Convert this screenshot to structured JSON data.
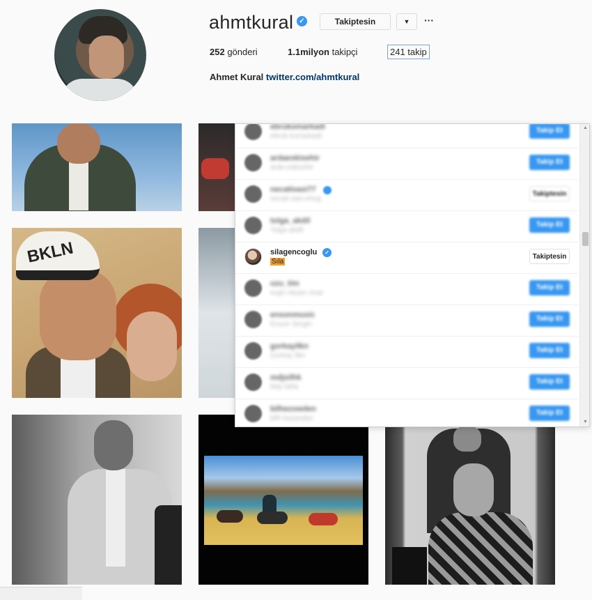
{
  "profile": {
    "username": "ahmtkural",
    "verified_mark": "✓",
    "follow_button": "Takiptesin",
    "dropdown_symbol": "▼",
    "more_symbol": "···",
    "posts_count": "252",
    "posts_label": "gönderi",
    "followers_count": "1.1milyon",
    "followers_label": "takipçi",
    "following_text": "241 takip",
    "bio_name": "Ahmet Kural",
    "bio_link": "twitter.com/ahmtkural"
  },
  "following_list": {
    "rows": [
      {
        "username": "ebrukomarkadi",
        "subtitle": "ebruk komarkadi",
        "button": "Takip Et",
        "verified": false
      },
      {
        "username": "ardaeskisehir",
        "subtitle": "arda eskisehir",
        "button": "Takip Et",
        "verified": false
      },
      {
        "username": "necatisasi77",
        "subtitle": "necati sasi ertug",
        "button": "Takiptesin",
        "verified": true
      },
      {
        "username": "tolga_akdil",
        "subtitle": "Tolga akdil",
        "button": "Takip Et",
        "verified": false
      },
      {
        "username": "silagencoglu",
        "subtitle": "Sıla",
        "button": "Takiptesin",
        "verified": true
      },
      {
        "username": "ozu_tim",
        "subtitle": "ergin okyan cinar",
        "button": "Takip Et",
        "verified": false
      },
      {
        "username": "ensonmusic",
        "subtitle": "Enson Sergin",
        "button": "Takip Et",
        "verified": false
      },
      {
        "username": "gorkayilkn",
        "subtitle": "Gorkay Ilkn",
        "button": "Takip Et",
        "verified": false
      },
      {
        "username": "mdjsilhk",
        "subtitle": "Mdj Silhk",
        "button": "Takip Et",
        "verified": false
      },
      {
        "username": "bilhezowden",
        "subtitle": "bilh kazandan",
        "button": "Takip Et",
        "verified": false
      }
    ]
  },
  "scroll": {
    "up": "▲",
    "down": "▼"
  },
  "photos": {
    "p3_cap_text": "BKLN"
  },
  "colors": {
    "accent": "#3897f0",
    "highlight": "#ef9f2e"
  }
}
